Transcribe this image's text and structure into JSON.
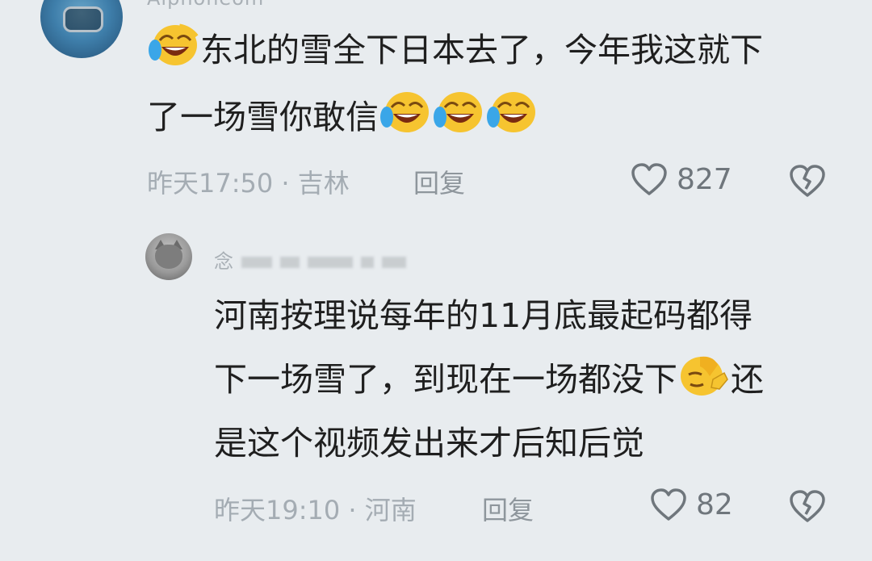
{
  "comments": [
    {
      "username": "Alphoneom",
      "line1": "东北的雪全下日本去了，今年我这就下",
      "line2": "了一场雪你敢信",
      "time": "昨天17:50",
      "location": "吉林",
      "reply_label": "回复",
      "likes": "827",
      "emojis": [
        "laughing-crying-emoji",
        "laughing-crying-emoji",
        "laughing-crying-emoji",
        "laughing-crying-emoji"
      ]
    },
    {
      "username": "念",
      "line1": "河南按理说每年的11月底最起码都得",
      "line2a": "下一场雪了，到现在一场都没下",
      "line2b": "还",
      "line3": "是这个视频发出来才后知后觉",
      "time": "昨天19:10",
      "location": "河南",
      "reply_label": "回复",
      "likes": "82",
      "emojis": [
        "facepalm-emoji"
      ]
    }
  ],
  "meta_separator": "·",
  "colors": {
    "background": "#e8ecef",
    "text": "#1f1f1f",
    "meta": "#a4acb3",
    "icon": "#6f767c",
    "emoji": "#f6c430"
  }
}
